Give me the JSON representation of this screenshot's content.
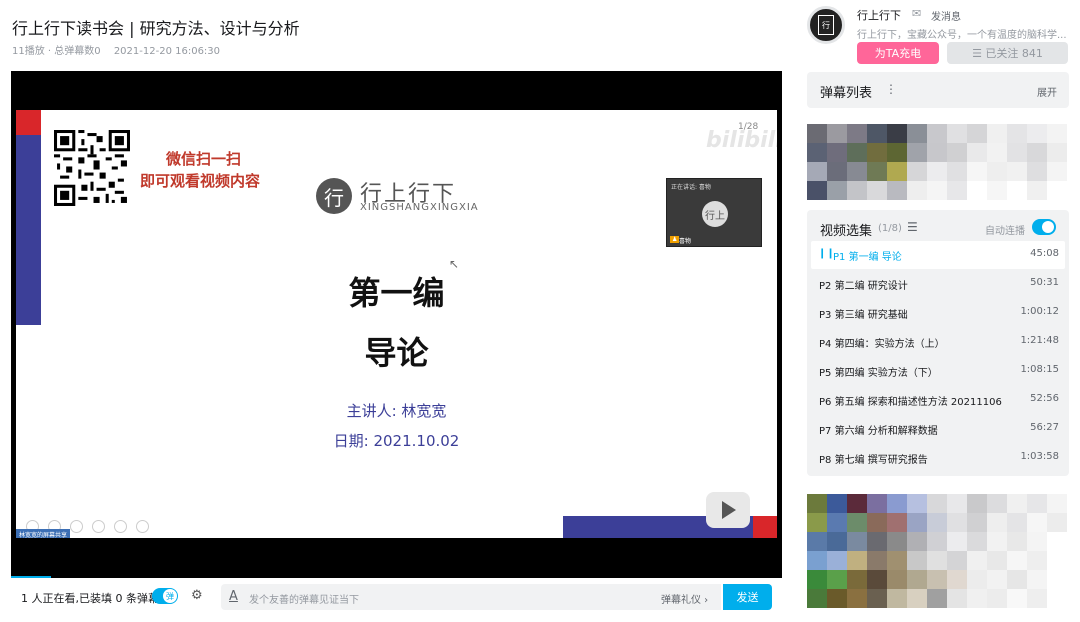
{
  "video": {
    "title": "行上行下读书会 | 研究方法、设计与分析",
    "plays": "11播放 · 总弹幕数0",
    "date": "2021-12-20 16:06:30"
  },
  "slide": {
    "qr_line1": "微信扫一扫",
    "qr_line2": "即可观看视频内容",
    "logo_glyph": "行",
    "logo_cn": "行上行下",
    "logo_en": "XINGSHANGXINGXIA",
    "title": "第一编",
    "subtitle": "导论",
    "presenter": "主讲人: 林宽宽",
    "date": "日期: 2021.10.02",
    "page": "1/28",
    "watermark": "bilibili",
    "pip_label": "正在讲话: 喜物",
    "pip_avatar": "行上",
    "pip_name": "喜物",
    "share_label": "林宽宽的屏幕共享"
  },
  "bottom_bar": {
    "watching": "1 人正在看,已装填 0 条弹幕",
    "danmaku_toggle": "弹",
    "input_icon": "A",
    "placeholder": "发个友善的弹幕见证当下",
    "etiquette": "弹幕礼仪 ›",
    "send": "发送"
  },
  "uploader": {
    "name": "行上行下",
    "send_msg": "发消息",
    "desc": "行上行下，宝藏公众号，一个有温度的脑科学...",
    "avatar_text": "行",
    "charge": "为TA充电",
    "follow": "☰ 已关注 841"
  },
  "danmaku_list": {
    "title": "弹幕列表",
    "more": "⋮",
    "expand": "展开"
  },
  "playlist": {
    "title": "视频选集",
    "count": "(1/8)",
    "autoplay": "自动连播",
    "items": [
      {
        "label": "P1  第一编 导论",
        "duration": "45:08"
      },
      {
        "label": "P2  第二编 研究设计",
        "duration": "50:31"
      },
      {
        "label": "P3  第三编 研究基础",
        "duration": "1:00:12"
      },
      {
        "label": "P4  第四编：实验方法（上）",
        "duration": "1:21:48"
      },
      {
        "label": "P5  第四编 实验方法（下）",
        "duration": "1:08:15"
      },
      {
        "label": "P6  第五编 探索和描述性方法 20211106",
        "duration": "52:56"
      },
      {
        "label": "P7  第六编    分析和解释数据",
        "duration": "56:27"
      },
      {
        "label": "P8  第七编    撰写研究报告",
        "duration": "1:03:58"
      }
    ]
  },
  "colors": {
    "accent": "#00aeec",
    "charge": "#ff6699",
    "slide_blue": "#3c3f98",
    "slide_red": "#d9262a"
  },
  "mosaic_top": [
    "#6b6b73",
    "#9b9aa0",
    "#7d7a86",
    "#4e5766",
    "#3a3d46",
    "#8a8f97",
    "#c8c8cc",
    "#e0e0e2",
    "#d5d5d7",
    "#f0f0f0",
    "#e4e4e6",
    "#ececee",
    "#f3f3f3",
    "#5b6274",
    "#6f6d7c",
    "#5e6e5a",
    "#716d3e",
    "#5d6633",
    "#a0a3aa",
    "#c7c7cb",
    "#d0d0d2",
    "#e9e9ea",
    "#f2f2f2",
    "#e2e2e4",
    "#d8d8da",
    "#ececec",
    "#a5a9b6",
    "#6b6d7a",
    "#878a93",
    "#6f7a55",
    "#b0a950",
    "#d6d6d8",
    "#ececee",
    "#e0e0e2",
    "#f6f6f6",
    "#eeeeee",
    "#f1f1f1",
    "#dedee0",
    "#f4f4f4",
    "#4a5168",
    "#9aa0a8",
    "#c3c4c8",
    "#d9d9db",
    "#b9bac0",
    "#eeeeee",
    "#f5f5f5",
    "#e7e7e9",
    "#ffffff",
    "#f6f6f6",
    "#ffffff",
    "#f0f0f0",
    "#ffffff"
  ],
  "mosaic_bottom": [
    "#6c7a3c",
    "#3c5a9a",
    "#5b2a3a",
    "#7b6fa0",
    "#8a9bd0",
    "#b6c0e0",
    "#d8d8da",
    "#e8e8ea",
    "#c9c9cb",
    "#dcdcde",
    "#f0f0f0",
    "#e6e6e8",
    "#f4f4f4",
    "#8a9a4a",
    "#5a7ab0",
    "#6c8c6a",
    "#8a6a5a",
    "#a07070",
    "#9aa4c4",
    "#c8ccd8",
    "#e0e0e2",
    "#d0d0d2",
    "#eeeeee",
    "#e4e4e6",
    "#f6f6f6",
    "#ececec",
    "#5a7aa8",
    "#4a6a98",
    "#7a8aa0",
    "#6a6a70",
    "#8a8a8a",
    "#b0b0b4",
    "#d0d0d4",
    "#ececee",
    "#dadadc",
    "#f2f2f2",
    "#e8e8e8",
    "#f4f4f4",
    "#ffffff",
    "#7aa0d0",
    "#9ab0d8",
    "#c0b080",
    "#8a7a6a",
    "#a09070",
    "#c8c8c8",
    "#e0e0e0",
    "#d4d4d6",
    "#f0f0f0",
    "#e8e8e8",
    "#f6f6f6",
    "#eeeeee",
    "#ffffff",
    "#3a8a3a",
    "#5aa04a",
    "#7a6a3a",
    "#5a4a3a",
    "#9a8a6a",
    "#b0a890",
    "#c8c0b0",
    "#e0d8d0",
    "#ececec",
    "#f2f2f2",
    "#e6e6e6",
    "#f4f4f4",
    "#ffffff",
    "#4a7a3a",
    "#6a5a2a",
    "#8a7040",
    "#6a6050",
    "#c0b8a0",
    "#d8d0c0",
    "#a0a0a0",
    "#e4e4e4",
    "#f0f0f0",
    "#ececec",
    "#f8f8f8",
    "#eeeeee",
    "#ffffff"
  ]
}
